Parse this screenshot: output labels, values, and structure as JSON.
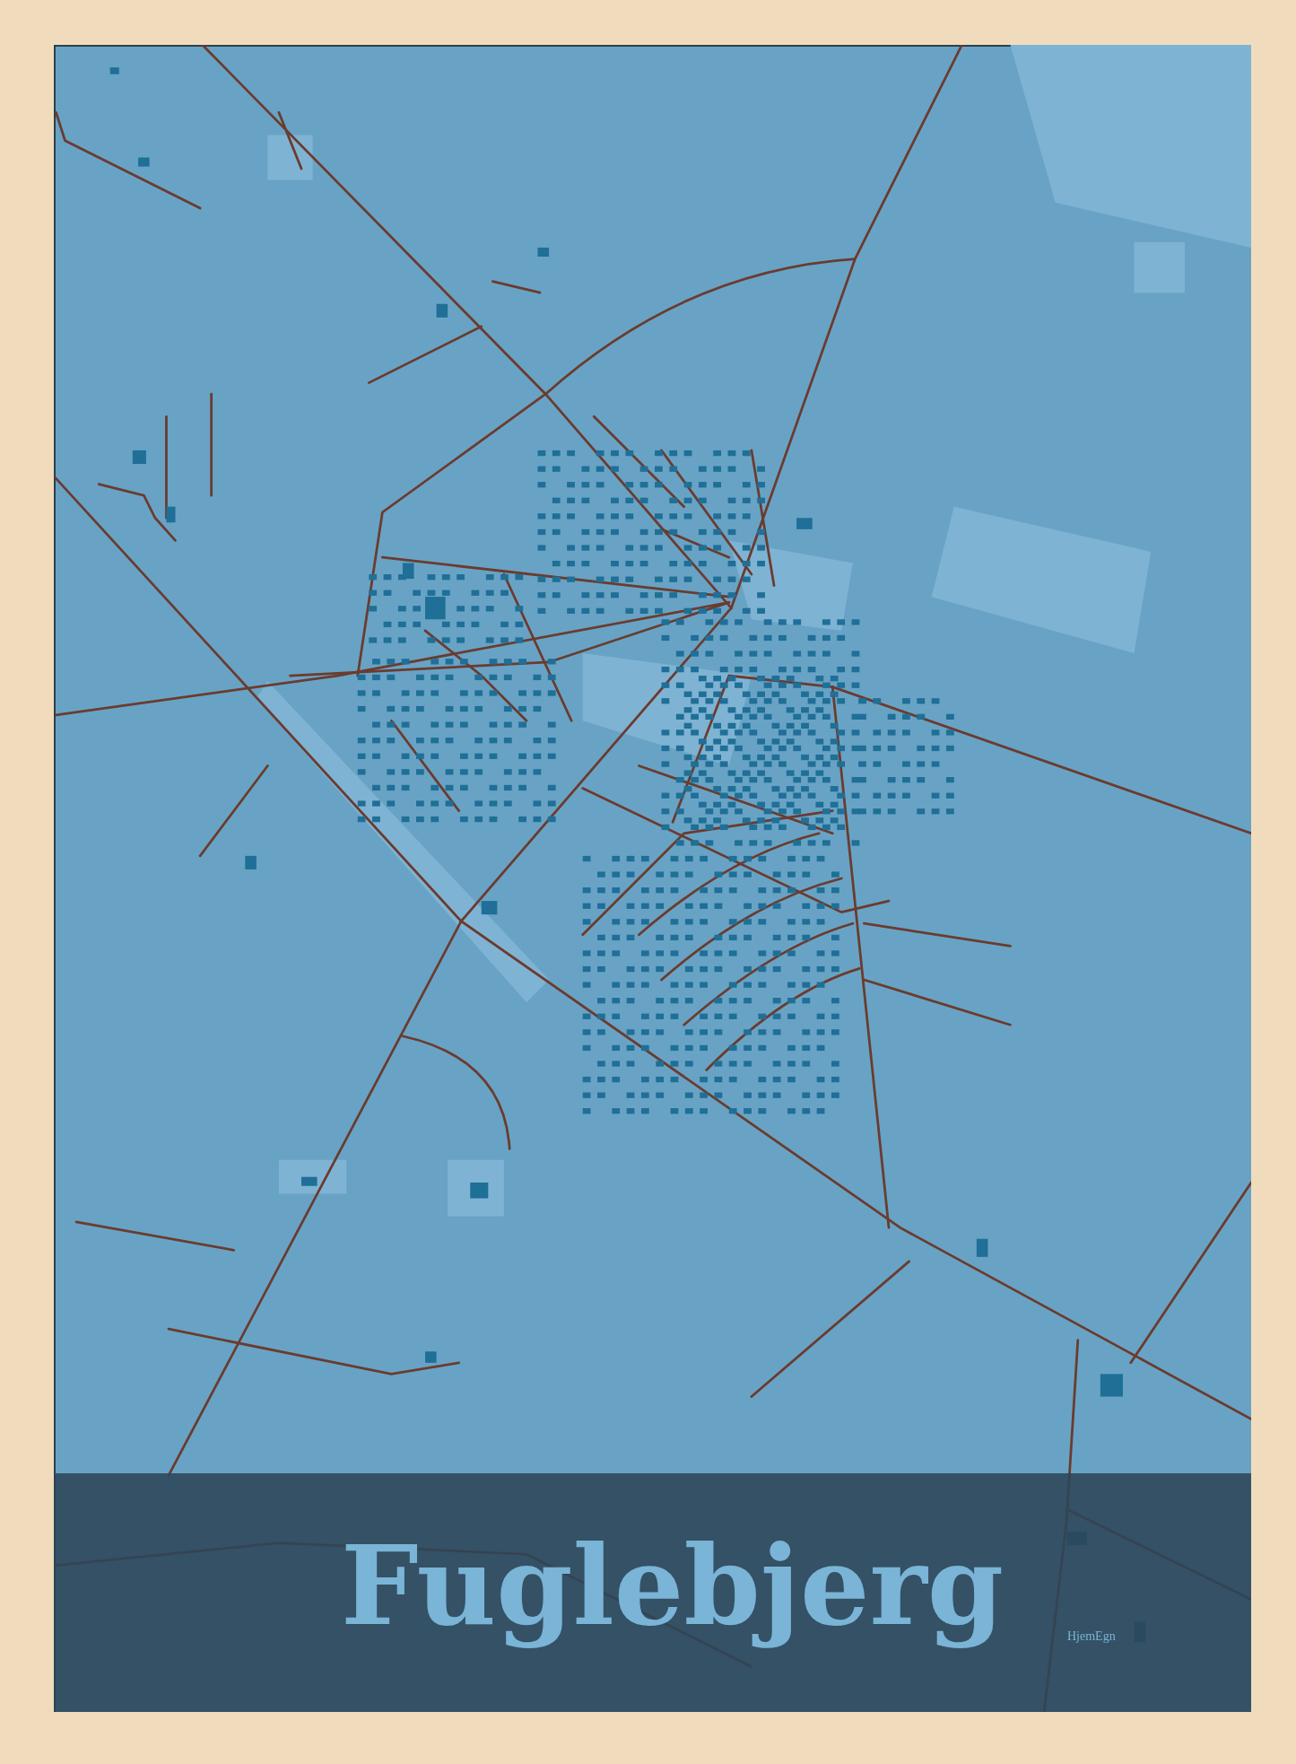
{
  "poster": {
    "title": "Fuglebjerg",
    "brand": "HjemEgn"
  }
}
